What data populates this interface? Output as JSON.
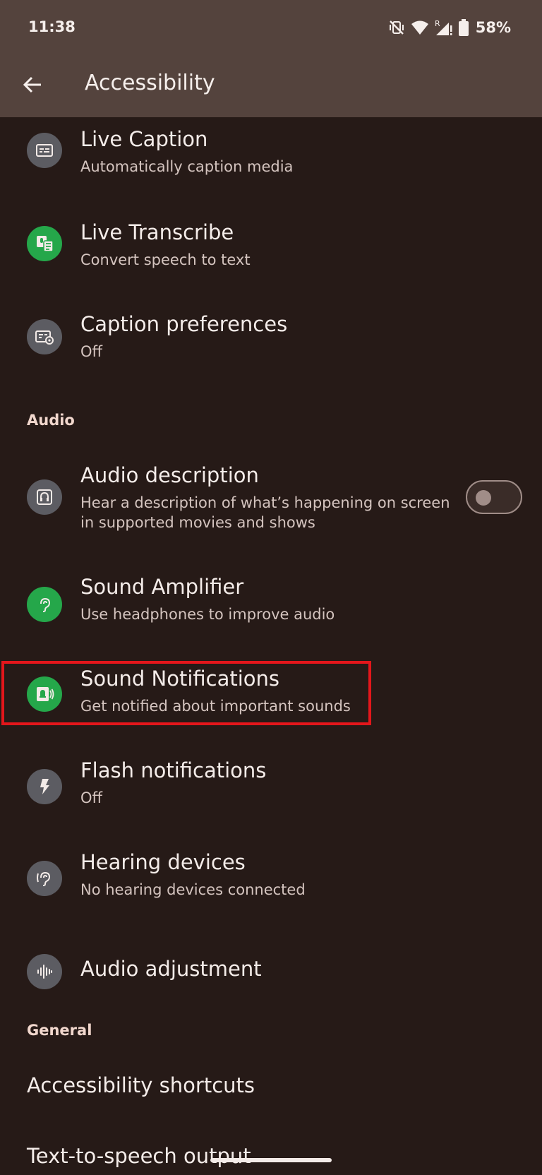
{
  "status_bar": {
    "time": "11:38",
    "battery_percent": "58%",
    "icons": [
      "vibrate-off-icon",
      "wifi-icon",
      "signal-roaming-icon",
      "battery-icon"
    ],
    "roaming_letter": "R"
  },
  "app_bar": {
    "title": "Accessibility",
    "back_icon": "arrow-back-icon"
  },
  "caption_items": [
    {
      "title": "Live Caption",
      "summary": "Automatically caption media",
      "icon": "caption-icon",
      "icon_color": "#5c5c62"
    },
    {
      "title": "Live Transcribe",
      "summary": "Convert speech to text",
      "icon": "transcribe-icon",
      "icon_color": "#25a74a"
    },
    {
      "title": "Caption preferences",
      "summary": "Off",
      "icon": "caption-settings-icon",
      "icon_color": "#5c5c62"
    }
  ],
  "audio_section": {
    "header": "Audio",
    "audio_description": {
      "title": "Audio description",
      "summary_line1": "Hear a description of what’s happening on screen",
      "summary_line2": "in supported movies and shows",
      "toggle_on": false
    },
    "sound_amplifier": {
      "title": "Sound Amplifier",
      "summary": "Use headphones to improve audio"
    },
    "sound_notifications": {
      "title": "Sound Notifications",
      "summary": "Get notified about important sounds",
      "highlighted": true
    },
    "flash_notifications": {
      "title": "Flash notifications",
      "summary": "Off"
    },
    "hearing_devices": {
      "title": "Hearing devices",
      "summary": "No hearing devices connected"
    },
    "audio_adjustment": {
      "title": "Audio adjustment"
    }
  },
  "general_section": {
    "header": "General",
    "items": [
      "Accessibility shortcuts",
      "Text-to-speech output"
    ]
  },
  "colors": {
    "app_bar": "#54433d",
    "background": "#261a17",
    "highlight": "#e3161b",
    "green_icon": "#25a74a",
    "grey_icon": "#5c5c62"
  }
}
